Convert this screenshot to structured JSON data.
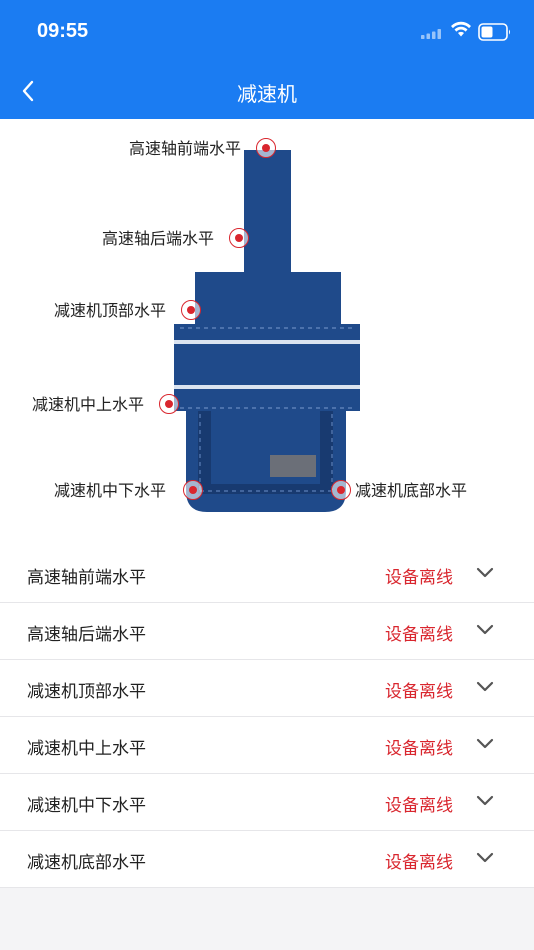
{
  "status_bar": {
    "time": "09:55",
    "icons": [
      "signal-icon",
      "wifi-icon",
      "battery-icon"
    ]
  },
  "nav": {
    "title": "减速机",
    "back_icon": "chevron-left-icon"
  },
  "diagram": {
    "labels": {
      "high_speed_front": "高速轴前端水平",
      "high_speed_rear": "高速轴后端水平",
      "reducer_top": "减速机顶部水平",
      "reducer_mid_upper": "减速机中上水平",
      "reducer_mid_lower": "减速机中下水平",
      "reducer_bottom": "减速机底部水平"
    },
    "colors": {
      "machine_body": "#1f4a8a",
      "machine_dark": "#183a70",
      "machine_light": "#2a5aa0",
      "marker": "#d9262e"
    }
  },
  "sensors": [
    {
      "name": "高速轴前端水平",
      "status": "设备离线"
    },
    {
      "name": "高速轴后端水平",
      "status": "设备离线"
    },
    {
      "name": "减速机顶部水平",
      "status": "设备离线"
    },
    {
      "name": "减速机中上水平",
      "status": "设备离线"
    },
    {
      "name": "减速机中下水平",
      "status": "设备离线"
    },
    {
      "name": "减速机底部水平",
      "status": "设备离线"
    }
  ],
  "theme": {
    "primary": "#1b7cf2",
    "offline": "#d9262e"
  }
}
